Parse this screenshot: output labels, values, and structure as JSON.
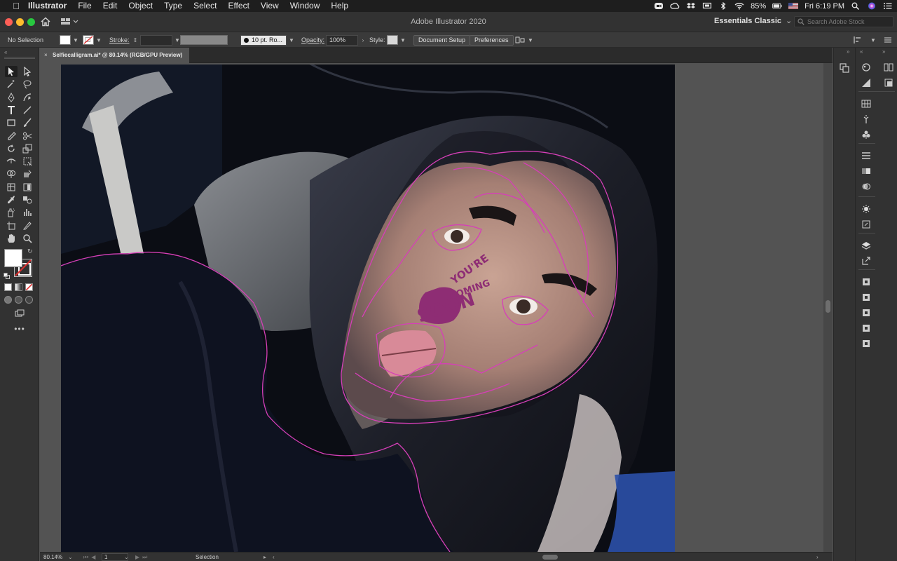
{
  "menubar": {
    "app_name": "Illustrator",
    "items": [
      "File",
      "Edit",
      "Object",
      "Type",
      "Select",
      "Effect",
      "View",
      "Window",
      "Help"
    ],
    "battery": "85%",
    "clock": "Fri 6:19 PM"
  },
  "window": {
    "title": "Adobe Illustrator 2020",
    "workspace": "Essentials Classic",
    "stock_search_placeholder": "Search Adobe Stock"
  },
  "control_bar": {
    "selection_status": "No Selection",
    "stroke_label": "Stroke:",
    "brush_label": "10 pt. Ro...",
    "opacity_label": "Opacity:",
    "opacity_value": "100%",
    "style_label": "Style:",
    "document_setup": "Document Setup",
    "preferences": "Preferences"
  },
  "document": {
    "tab_title": "Selfiecalligram.ai* @ 80.14% (RGB/GPU Preview)",
    "calligram_words": [
      "YOU'RE",
      "COMING",
      "SOON"
    ]
  },
  "status_bar": {
    "zoom": "80.14%",
    "artboard_number": "1",
    "tool_name": "Selection"
  },
  "colors": {
    "guide_stroke": "#d63fb8",
    "calligram_fill": "#8e2d74",
    "ui_panel": "#323232",
    "canvas": "#535353"
  }
}
